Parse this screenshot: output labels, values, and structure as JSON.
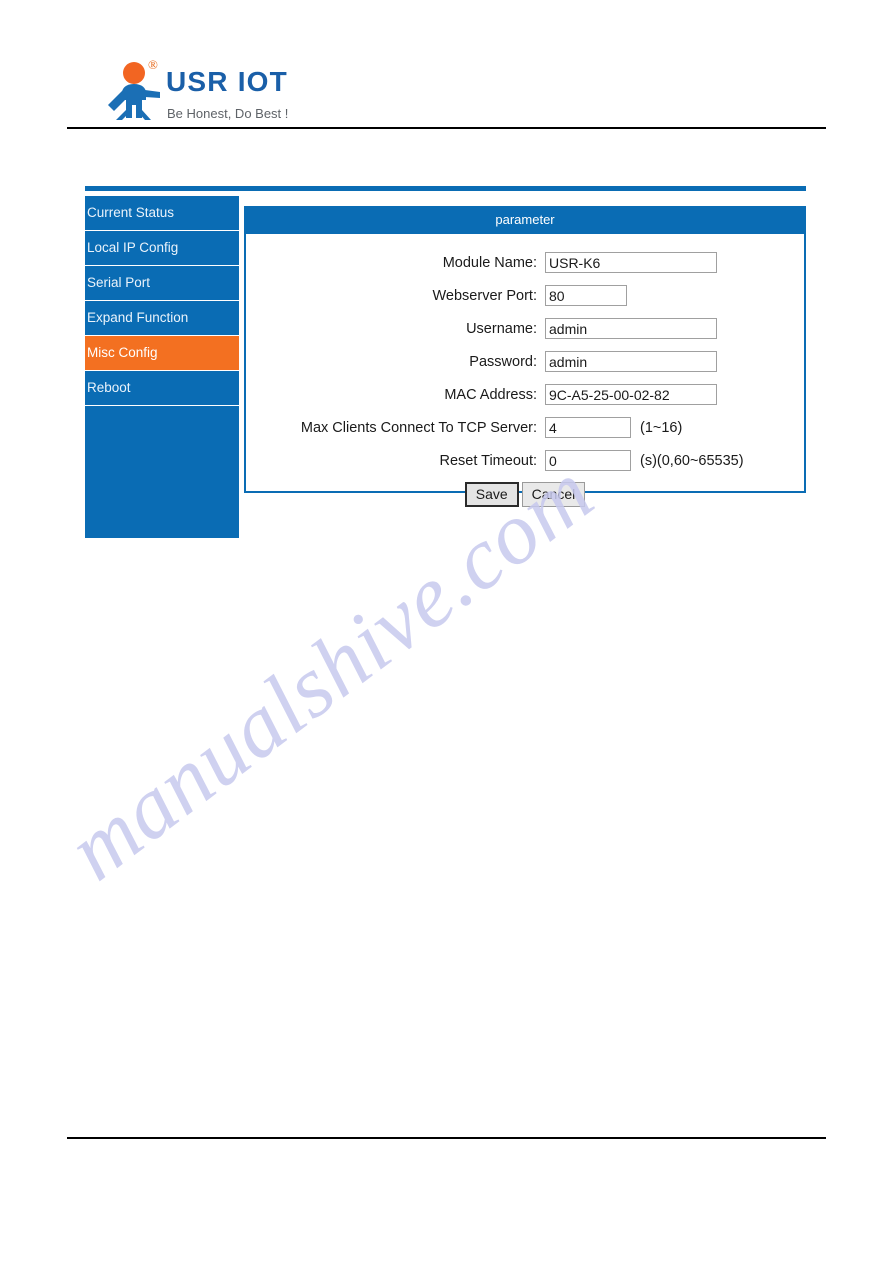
{
  "header": {
    "logo_title": "USR IOT",
    "logo_registered": "®",
    "logo_tagline": "Be Honest, Do Best !",
    "logo_icon": "usr-iot-figure-logo"
  },
  "sidebar": {
    "items": [
      {
        "label": "Current Status",
        "active": false
      },
      {
        "label": "Local IP Config",
        "active": false
      },
      {
        "label": "Serial Port",
        "active": false
      },
      {
        "label": "Expand Function",
        "active": false
      },
      {
        "label": "Misc Config",
        "active": true
      },
      {
        "label": "Reboot",
        "active": false
      }
    ]
  },
  "panel": {
    "title": "parameter",
    "fields": [
      {
        "label": "Module Name:",
        "value": "USR-K6",
        "hint": "",
        "width": "wide"
      },
      {
        "label": "Webserver Port:",
        "value": "80",
        "hint": "",
        "width": "mid"
      },
      {
        "label": "Username:",
        "value": "admin",
        "hint": "",
        "width": "wide"
      },
      {
        "label": "Password:",
        "value": "admin",
        "hint": "",
        "width": "wide"
      },
      {
        "label": "MAC Address:",
        "value": "9C-A5-25-00-02-82",
        "hint": "",
        "width": "wide"
      },
      {
        "label": "Max Clients Connect To TCP Server:",
        "value": "4",
        "hint": "(1~16)",
        "width": "num"
      },
      {
        "label": "Reset Timeout:",
        "value": "0",
        "hint": "(s)(0,60~65535)",
        "width": "num"
      }
    ]
  },
  "buttons": {
    "save": "Save",
    "cancel": "Cancel"
  },
  "watermark": {
    "text": "manualshive.com"
  },
  "colors": {
    "brand_blue": "#0a6cb4",
    "accent_orange": "#f37021",
    "logo_blue": "#1a5fa8",
    "watermark": "#c7c9ee"
  }
}
